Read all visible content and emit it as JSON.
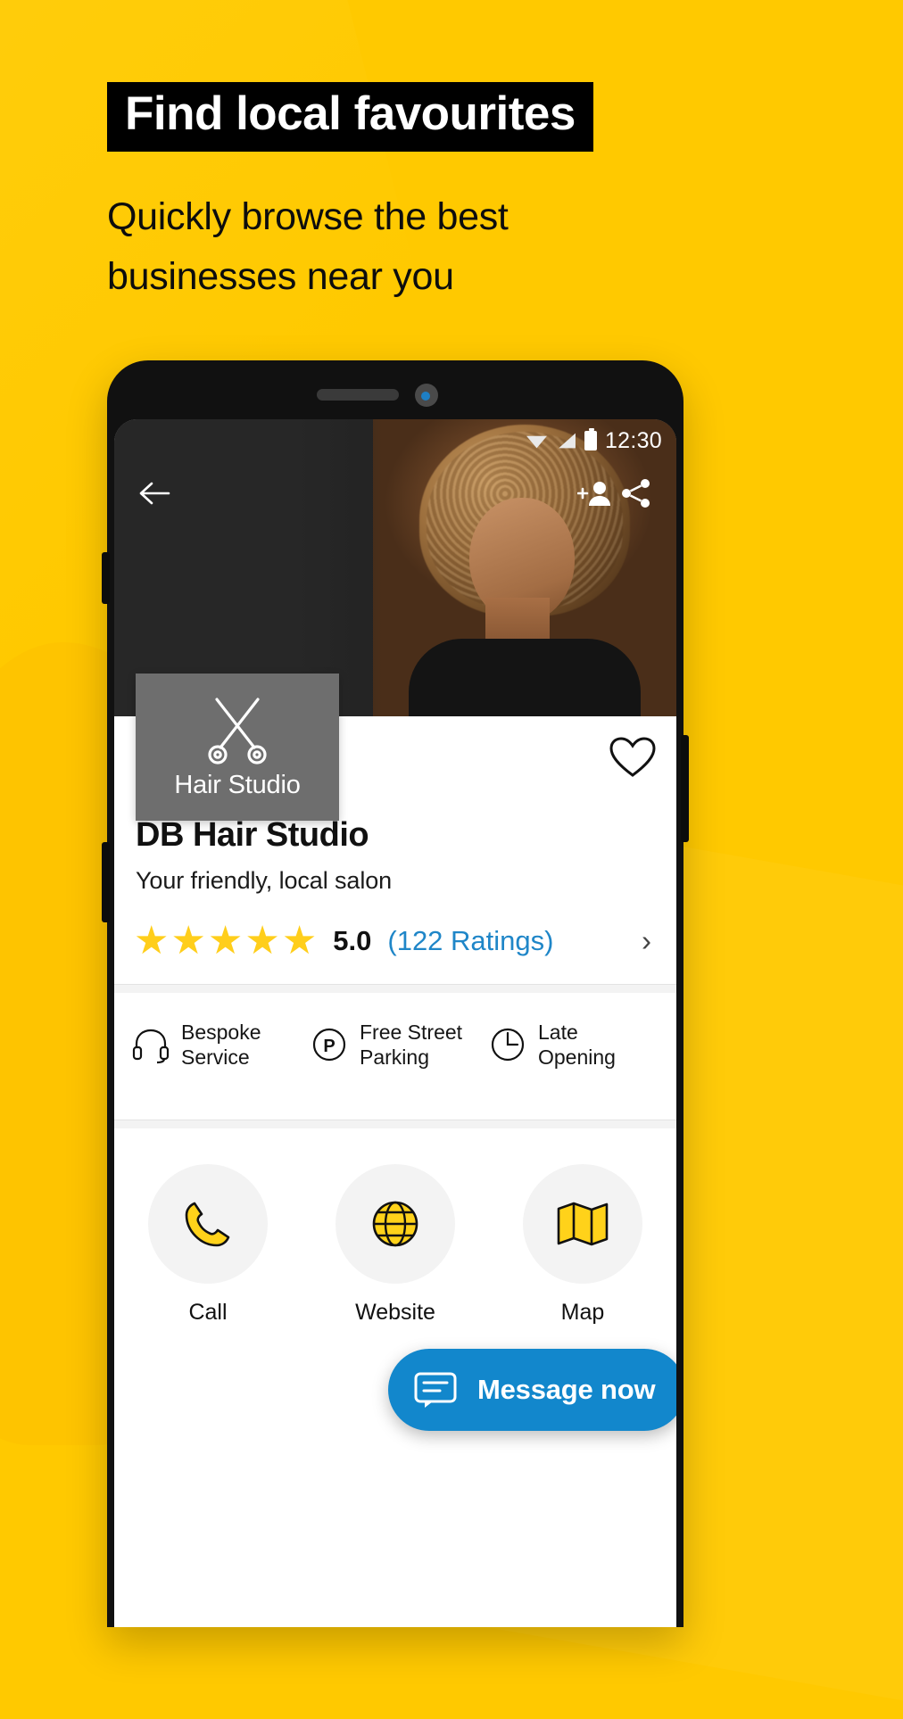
{
  "promo": {
    "headline": "Find local favourites",
    "subheadline": "Quickly browse the best businesses near you",
    "background_color": "#FFC900",
    "headline_band_color": "#000000"
  },
  "phone": {
    "status_bar": {
      "time": "12:30",
      "icons": [
        "wifi-icon",
        "signal-icon",
        "battery-icon"
      ]
    },
    "nav": {
      "back_icon": "back-arrow-icon",
      "add_contact_icon": "add-person-icon",
      "share_icon": "share-icon"
    },
    "logo_tile": {
      "icon": "scissors-icon",
      "label": "Hair Studio"
    },
    "favourite_icon": "heart-icon",
    "business": {
      "name": "DB Hair Studio",
      "tagline": "Your friendly, local salon"
    },
    "rating": {
      "stars": 5,
      "star_glyph": "★",
      "score": "5.0",
      "count_label": "(122 Ratings)",
      "chevron": "›",
      "star_color": "#FFCE1B",
      "link_color": "#1F86C8"
    },
    "features": [
      {
        "icon": "headset-icon",
        "line1": "Bespoke",
        "line2": "Service"
      },
      {
        "icon": "parking-icon",
        "line1": "Free Street",
        "line2": "Parking"
      },
      {
        "icon": "clock-icon",
        "line1": "Late",
        "line2": "Opening"
      }
    ],
    "actions": [
      {
        "icon": "phone-icon",
        "label": "Call"
      },
      {
        "icon": "globe-icon",
        "label": "Website"
      },
      {
        "icon": "map-icon",
        "label": "Map"
      }
    ],
    "message_button": {
      "icon": "chat-bubble-icon",
      "label": "Message now",
      "color": "#1287CC"
    }
  }
}
